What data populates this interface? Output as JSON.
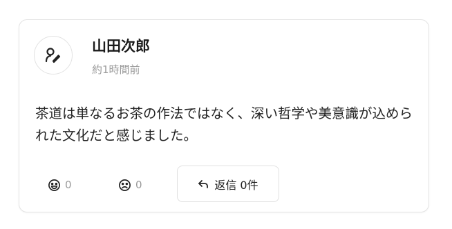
{
  "post": {
    "author_name": "山田次郎",
    "timestamp": "約1時間前",
    "body": "茶道は単なるお茶の作法ではなく、深い哲学や美意識が込められた文化だと感じました。",
    "avatar_icon": "user-icon"
  },
  "reactions": {
    "smile": {
      "icon": "smile-icon",
      "count": "0"
    },
    "frown": {
      "icon": "frown-icon",
      "count": "0"
    }
  },
  "reply": {
    "icon": "reply-arrow-icon",
    "label": "返信",
    "count_text": "0件"
  },
  "colors": {
    "text": "#222222",
    "muted": "#9a9a9a",
    "border": "#e3e3e3"
  }
}
